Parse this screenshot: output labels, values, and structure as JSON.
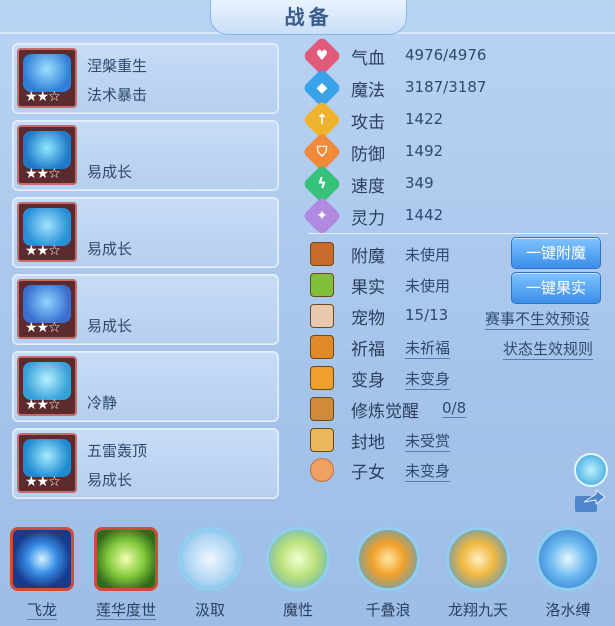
{
  "title": "战备",
  "pets": [
    {
      "line1": "涅槃重生",
      "line2": "法术暴击",
      "stars": "★★☆",
      "color": "#2f7fd8"
    },
    {
      "line1": "",
      "line2": "易成长",
      "stars": "★★☆",
      "color": "#2a8fd6"
    },
    {
      "line1": "",
      "line2": "易成长",
      "stars": "★★☆",
      "color": "#2a8fd6"
    },
    {
      "line1": "",
      "line2": "易成长",
      "stars": "★★☆",
      "color": "#3a7fd8"
    },
    {
      "line1": "",
      "line2": "冷静",
      "stars": "★★☆",
      "color": "#36a0d8"
    },
    {
      "line1": "五雷轰顶",
      "line2": "易成长",
      "stars": "★★☆",
      "color": "#2a8fd6"
    }
  ],
  "stats": [
    {
      "label": "气血",
      "value": "4976/4976",
      "icon": "heart-icon",
      "color": "#e05a7a",
      "glyph": "♥"
    },
    {
      "label": "魔法",
      "value": "3187/3187",
      "icon": "mana-icon",
      "color": "#3aa2ea",
      "glyph": "◆"
    },
    {
      "label": "攻击",
      "value": "1422",
      "icon": "sword-icon",
      "color": "#f0b32e",
      "glyph": "↑"
    },
    {
      "label": "防御",
      "value": "1492",
      "icon": "shield-icon",
      "color": "#f08a3a",
      "glyph": "⛉"
    },
    {
      "label": "速度",
      "value": "349",
      "icon": "speed-icon",
      "color": "#36c27a",
      "glyph": "ϟ"
    },
    {
      "label": "灵力",
      "value": "1442",
      "icon": "spirit-icon",
      "color": "#b08ae0",
      "glyph": "✦"
    }
  ],
  "extras": [
    {
      "label": "附魔",
      "value": "未使用",
      "icon": "enchant-icon",
      "underline": false
    },
    {
      "label": "果实",
      "value": "未使用",
      "icon": "fruit-icon",
      "underline": false
    },
    {
      "label": "宠物",
      "value": "15/13",
      "icon": "pet-icon",
      "underline": false
    },
    {
      "label": "祈福",
      "value": "未祈福",
      "icon": "blessing-icon",
      "underline": true
    },
    {
      "label": "变身",
      "value": "未变身",
      "icon": "transform-icon",
      "underline": true
    },
    {
      "label": "修炼觉醒",
      "value": "0/8",
      "icon": "cultivation-icon",
      "underline": true
    },
    {
      "label": "封地",
      "value": "未受赏",
      "icon": "fief-icon",
      "underline": true
    },
    {
      "label": "子女",
      "value": "未变身",
      "icon": "child-icon",
      "underline": true
    }
  ],
  "buttons": {
    "enchant": "一键附魔",
    "fruit": "一键果实",
    "preset": "赛事不生效预设",
    "rules": "状态生效规则"
  },
  "skills": [
    {
      "name": "飞龙",
      "underline": true
    },
    {
      "name": "莲华度世",
      "underline": true
    },
    {
      "name": "汲取",
      "underline": false
    },
    {
      "name": "魔性",
      "underline": false
    },
    {
      "name": "千叠浪",
      "underline": false
    },
    {
      "name": "龙翔九天",
      "underline": false
    },
    {
      "name": "洛水缚",
      "underline": false
    }
  ]
}
